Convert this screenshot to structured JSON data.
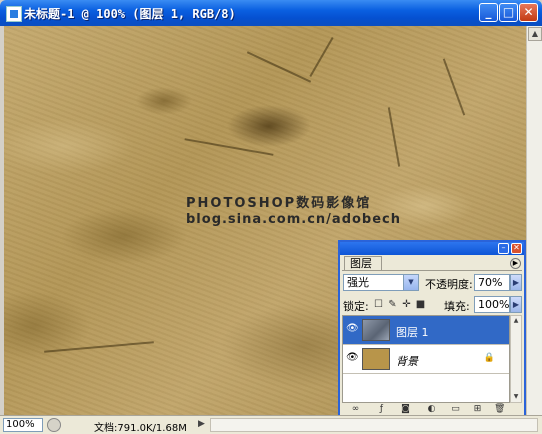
{
  "window": {
    "title": "未标题-1 @ 100% (图层 1, RGB/8)",
    "minimize_glyph": "_",
    "maximize_glyph": "□",
    "close_glyph": "✕"
  },
  "canvas": {
    "watermark_line1": "PHOTOSHOP数码影像馆",
    "watermark_line2": "blog.sina.com.cn/adobech"
  },
  "statusbar": {
    "zoom": "100%",
    "doc_info": "文档:791.0K/1.68M"
  },
  "layers_panel": {
    "tab_label": "图层",
    "blend_mode": "强光",
    "opacity_label": "不透明度:",
    "opacity_value": "70%",
    "lock_label": "锁定:",
    "fill_label": "填充:",
    "fill_value": "100%",
    "layers": [
      {
        "name": "图层 1",
        "selected": true,
        "visible": true
      },
      {
        "name": "背景",
        "selected": false,
        "visible": true,
        "locked": true
      }
    ]
  },
  "colors": {
    "title_bar": "#0a5fe0",
    "selected_layer": "#3169c6",
    "background_swatch": "#b8954a"
  }
}
